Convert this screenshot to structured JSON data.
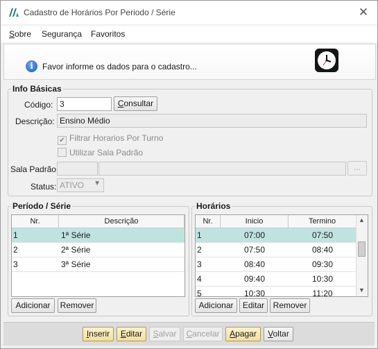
{
  "window": {
    "title": "Cadastro de Horários Por Periodo / Série",
    "close_icon": "✕"
  },
  "menu": [
    {
      "label": "Sobre"
    },
    {
      "label": "Segurança"
    },
    {
      "label": "Favoritos"
    }
  ],
  "info": {
    "message": "Favor informe os dados para o cadastro..."
  },
  "basic": {
    "legend": "Info Básicas",
    "codigo_label": "Código:",
    "codigo_value": "3",
    "consultar_label": "Consultar",
    "descricao_label": "Descrição:",
    "descricao_value": "Ensino Médio",
    "filtrar_label": "Filtrar Horarios Por Turno",
    "filtrar_checked": true,
    "utilizar_label": "Utilizar Sala Padrão",
    "utilizar_checked": false,
    "sala_label": "Sala Padrão:",
    "sala_code": "",
    "sala_name": "",
    "sala_browse": "...",
    "status_label": "Status:",
    "status_value": "ATIVO"
  },
  "periodo": {
    "legend": "Período / Série",
    "headers": [
      "Nr.",
      "Descrição"
    ],
    "rows": [
      {
        "nr": "1",
        "desc": "1ª Série"
      },
      {
        "nr": "2",
        "desc": "2ª Série"
      },
      {
        "nr": "3",
        "desc": "3ª Série"
      }
    ],
    "add_label": "Adicionar",
    "remove_label": "Remover"
  },
  "horarios": {
    "legend": "Horários",
    "headers": [
      "Nr.",
      "Inicio",
      "Termino"
    ],
    "rows": [
      {
        "nr": "1",
        "inicio": "07:00",
        "termino": "07:50"
      },
      {
        "nr": "2",
        "inicio": "07:50",
        "termino": "08:40"
      },
      {
        "nr": "3",
        "inicio": "08:40",
        "termino": "09:30"
      },
      {
        "nr": "4",
        "inicio": "09:40",
        "termino": "10:30"
      },
      {
        "nr": "5",
        "inicio": "10:30",
        "termino": "11:20"
      }
    ],
    "add_label": "Adicionar",
    "edit_label": "Editar",
    "remove_label": "Remover"
  },
  "actions": {
    "inserir": "Inserir",
    "editar": "Editar",
    "salvar": "Salvar",
    "cancelar": "Cancelar",
    "apagar": "Apagar",
    "voltar": "Voltar"
  },
  "colors": {
    "selected_row": "#bfe4e0",
    "action_button": "#f0dfa0",
    "info_icon": "#1657c4"
  }
}
